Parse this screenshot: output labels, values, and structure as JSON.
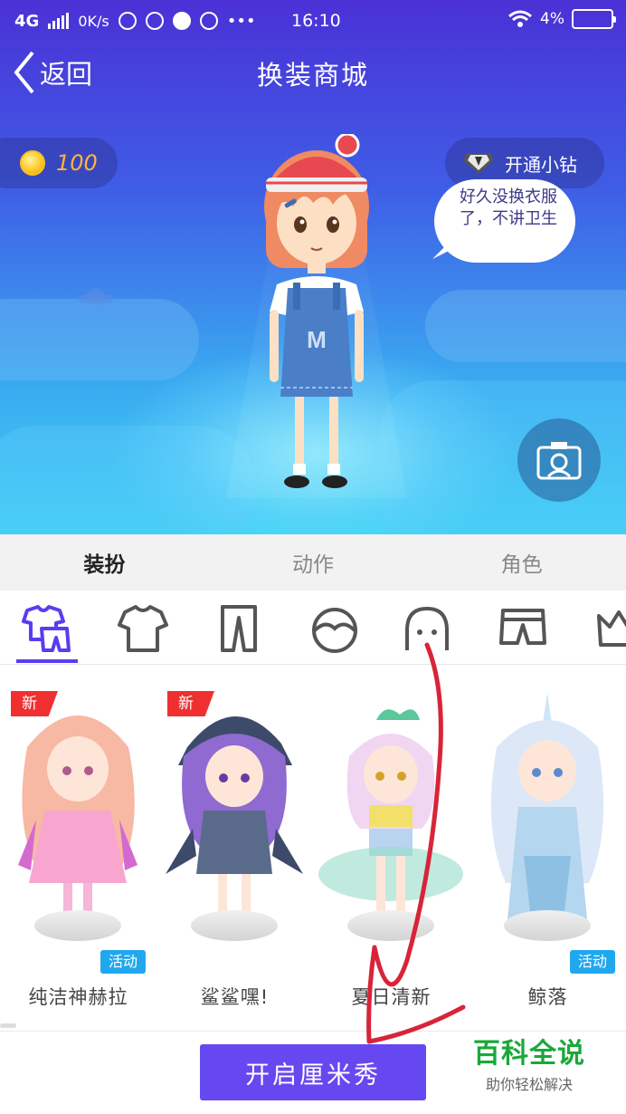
{
  "status_bar": {
    "network": "4G",
    "speed": "0K/s",
    "time": "16:10",
    "battery": "4%"
  },
  "header": {
    "back_label": "返回",
    "title": "换装商城"
  },
  "coins": {
    "amount": "100"
  },
  "vip": {
    "label": "开通小钻"
  },
  "speech_bubble": {
    "text": "好久没换衣服了，不讲卫生"
  },
  "tabs": [
    {
      "label": "装扮",
      "active": true
    },
    {
      "label": "动作",
      "active": false
    },
    {
      "label": "角色",
      "active": false
    }
  ],
  "categories": [
    {
      "icon": "outfit-set-icon",
      "active": true
    },
    {
      "icon": "tshirt-icon",
      "active": false
    },
    {
      "icon": "pants-icon",
      "active": false
    },
    {
      "icon": "hair-icon",
      "active": false
    },
    {
      "icon": "face-icon",
      "active": false
    },
    {
      "icon": "shorts-icon",
      "active": false
    },
    {
      "icon": "crown-icon",
      "active": false
    }
  ],
  "items": [
    {
      "name": "纯洁神赫拉",
      "new_badge": "新",
      "event_badge": "活动"
    },
    {
      "name": "鲨鲨嘿!",
      "new_badge": "新",
      "event_badge": ""
    },
    {
      "name": "夏日清新",
      "new_badge": "",
      "event_badge": ""
    },
    {
      "name": "鲸落",
      "new_badge": "",
      "event_badge": "活动"
    }
  ],
  "cta": {
    "label": "开启厘米秀"
  },
  "watermark": {
    "title": "百科全说",
    "subtitle": "助你轻松解决"
  },
  "colors": {
    "accent": "#6648f0",
    "new_badge": "#f03030",
    "event_badge": "#20a8ee",
    "annotation": "#d8243a"
  }
}
